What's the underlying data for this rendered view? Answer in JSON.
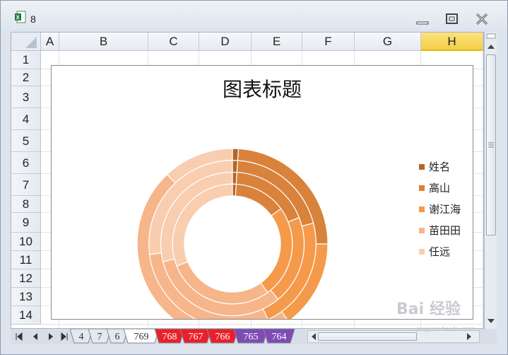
{
  "window": {
    "title": "8"
  },
  "columns": [
    "A",
    "B",
    "C",
    "D",
    "E",
    "F",
    "G",
    "H"
  ],
  "selected_column": "H",
  "rows": [
    "1",
    "2",
    "3",
    "4",
    "5",
    "6",
    "7",
    "8",
    "9",
    "10",
    "11",
    "12",
    "13",
    "14"
  ],
  "sheet_tabs": [
    "4",
    "7",
    "6",
    "769",
    "768",
    "767",
    "766",
    "765",
    "764"
  ],
  "active_tab": "769",
  "watermark": {
    "text": "Bai 经验",
    "sub": "jingyan.baidu.com"
  },
  "chart_data": {
    "type": "doughnut",
    "title": "图表标题",
    "legend": [
      "姓名",
      "高山",
      "谢江海",
      "苗田田",
      "任远"
    ],
    "legend_position": "right",
    "colors": [
      "#b5652a",
      "#d9823b",
      "#f59a4a",
      "#f7b58a",
      "#f9cdb0"
    ],
    "rings": [
      {
        "values": [
          1,
          24,
          15,
          48,
          12
        ]
      },
      {
        "values": [
          1,
          20,
          22,
          30,
          27
        ]
      },
      {
        "values": [
          1,
          18,
          20,
          32,
          29
        ]
      },
      {
        "values": [
          1,
          14,
          25,
          29,
          31
        ]
      }
    ]
  }
}
